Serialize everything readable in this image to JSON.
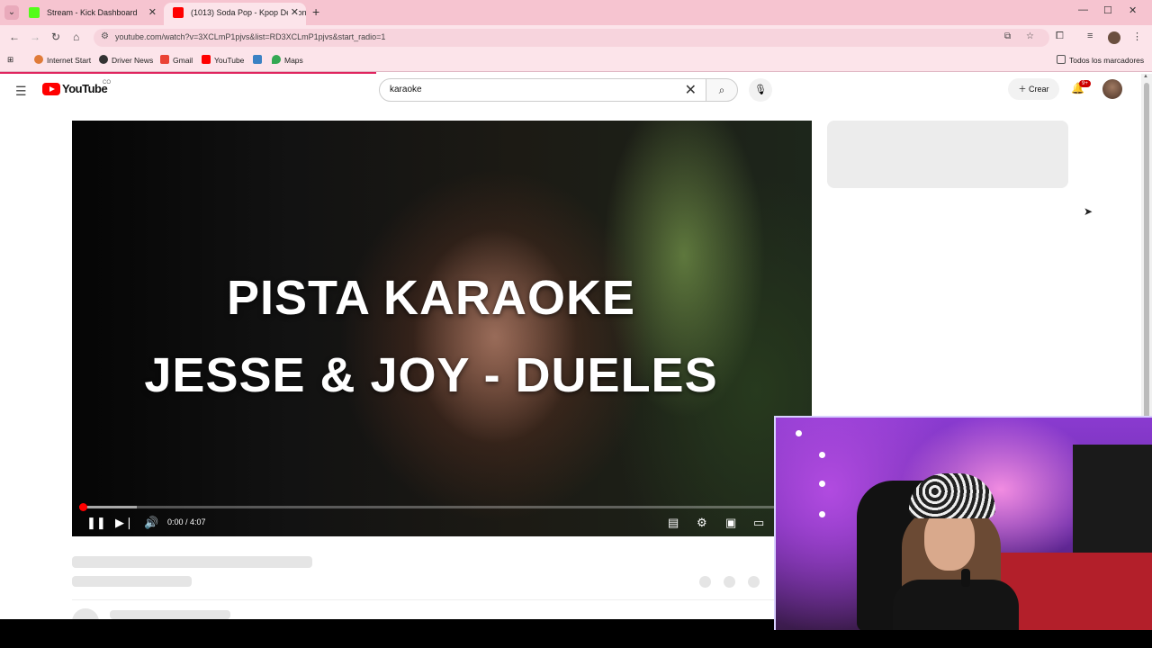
{
  "browser": {
    "tabs": [
      {
        "title": "Stream - Kick Dashboard",
        "favicon_color": "#53fc18",
        "active": false
      },
      {
        "title": "(1013) Soda Pop - Kpop Demon",
        "favicon_color": "#ff0000",
        "active": true
      }
    ],
    "url": "youtube.com/watch?v=3XCLmP1pjvs&list=RD3XCLmP1pjvs&start_radio=1",
    "bookmarks": [
      {
        "label": "Internet Start",
        "icon": "globe-icon"
      },
      {
        "label": "Driver News",
        "icon": "news-icon"
      },
      {
        "label": "Gmail",
        "icon": "gmail-icon"
      },
      {
        "label": "YouTube",
        "icon": "youtube-icon"
      },
      {
        "label": "",
        "icon": "app-icon"
      },
      {
        "label": "Maps",
        "icon": "maps-icon"
      }
    ],
    "all_bookmarks": "Todos los marcadores",
    "theme_color": "#f6c4d0"
  },
  "youtube": {
    "logo": "YouTube",
    "logo_suffix": "CO",
    "search_query": "karaoke",
    "create_label": "Crear",
    "notification_badge": "9+",
    "player": {
      "title_line1": "PISTA KARAOKE",
      "title_line2": "JESSE & JOY - DUELES",
      "time": "0:00 / 4:07",
      "played_fraction": 0.005,
      "buffered_fraction": 0.08
    }
  }
}
